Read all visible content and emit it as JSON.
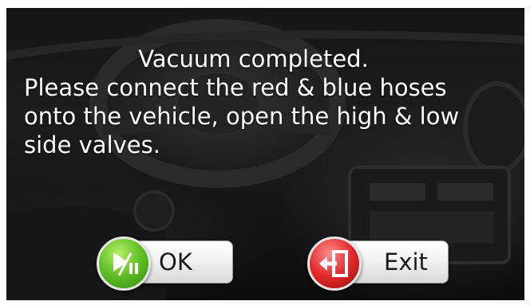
{
  "dialog": {
    "title": "Vacuum completed.",
    "line1": "Please connect the red & blue hoses",
    "line2": "onto the vehicle, open the high & low",
    "line3": "side valves."
  },
  "buttons": {
    "ok_label": "OK",
    "exit_label": "Exit",
    "ok_icon": "play-pause-icon",
    "exit_icon": "exit-door-icon"
  },
  "colors": {
    "ok_accent": "#4aa81a",
    "exit_accent": "#d42222",
    "text": "#ffffff"
  }
}
